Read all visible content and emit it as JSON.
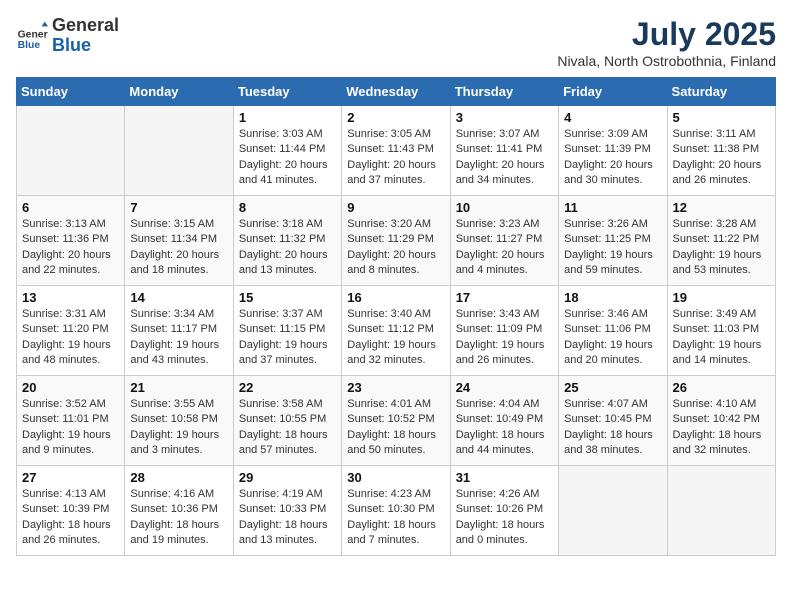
{
  "header": {
    "logo": {
      "general": "General",
      "blue": "Blue"
    },
    "title": "July 2025",
    "subtitle": "Nivala, North Ostrobothnia, Finland"
  },
  "columns": [
    "Sunday",
    "Monday",
    "Tuesday",
    "Wednesday",
    "Thursday",
    "Friday",
    "Saturday"
  ],
  "weeks": [
    [
      {
        "day": "",
        "info": ""
      },
      {
        "day": "",
        "info": ""
      },
      {
        "day": "1",
        "info": "Sunrise: 3:03 AM\nSunset: 11:44 PM\nDaylight: 20 hours\nand 41 minutes."
      },
      {
        "day": "2",
        "info": "Sunrise: 3:05 AM\nSunset: 11:43 PM\nDaylight: 20 hours\nand 37 minutes."
      },
      {
        "day": "3",
        "info": "Sunrise: 3:07 AM\nSunset: 11:41 PM\nDaylight: 20 hours\nand 34 minutes."
      },
      {
        "day": "4",
        "info": "Sunrise: 3:09 AM\nSunset: 11:39 PM\nDaylight: 20 hours\nand 30 minutes."
      },
      {
        "day": "5",
        "info": "Sunrise: 3:11 AM\nSunset: 11:38 PM\nDaylight: 20 hours\nand 26 minutes."
      }
    ],
    [
      {
        "day": "6",
        "info": "Sunrise: 3:13 AM\nSunset: 11:36 PM\nDaylight: 20 hours\nand 22 minutes."
      },
      {
        "day": "7",
        "info": "Sunrise: 3:15 AM\nSunset: 11:34 PM\nDaylight: 20 hours\nand 18 minutes."
      },
      {
        "day": "8",
        "info": "Sunrise: 3:18 AM\nSunset: 11:32 PM\nDaylight: 20 hours\nand 13 minutes."
      },
      {
        "day": "9",
        "info": "Sunrise: 3:20 AM\nSunset: 11:29 PM\nDaylight: 20 hours\nand 8 minutes."
      },
      {
        "day": "10",
        "info": "Sunrise: 3:23 AM\nSunset: 11:27 PM\nDaylight: 20 hours\nand 4 minutes."
      },
      {
        "day": "11",
        "info": "Sunrise: 3:26 AM\nSunset: 11:25 PM\nDaylight: 19 hours\nand 59 minutes."
      },
      {
        "day": "12",
        "info": "Sunrise: 3:28 AM\nSunset: 11:22 PM\nDaylight: 19 hours\nand 53 minutes."
      }
    ],
    [
      {
        "day": "13",
        "info": "Sunrise: 3:31 AM\nSunset: 11:20 PM\nDaylight: 19 hours\nand 48 minutes."
      },
      {
        "day": "14",
        "info": "Sunrise: 3:34 AM\nSunset: 11:17 PM\nDaylight: 19 hours\nand 43 minutes."
      },
      {
        "day": "15",
        "info": "Sunrise: 3:37 AM\nSunset: 11:15 PM\nDaylight: 19 hours\nand 37 minutes."
      },
      {
        "day": "16",
        "info": "Sunrise: 3:40 AM\nSunset: 11:12 PM\nDaylight: 19 hours\nand 32 minutes."
      },
      {
        "day": "17",
        "info": "Sunrise: 3:43 AM\nSunset: 11:09 PM\nDaylight: 19 hours\nand 26 minutes."
      },
      {
        "day": "18",
        "info": "Sunrise: 3:46 AM\nSunset: 11:06 PM\nDaylight: 19 hours\nand 20 minutes."
      },
      {
        "day": "19",
        "info": "Sunrise: 3:49 AM\nSunset: 11:03 PM\nDaylight: 19 hours\nand 14 minutes."
      }
    ],
    [
      {
        "day": "20",
        "info": "Sunrise: 3:52 AM\nSunset: 11:01 PM\nDaylight: 19 hours\nand 9 minutes."
      },
      {
        "day": "21",
        "info": "Sunrise: 3:55 AM\nSunset: 10:58 PM\nDaylight: 19 hours\nand 3 minutes."
      },
      {
        "day": "22",
        "info": "Sunrise: 3:58 AM\nSunset: 10:55 PM\nDaylight: 18 hours\nand 57 minutes."
      },
      {
        "day": "23",
        "info": "Sunrise: 4:01 AM\nSunset: 10:52 PM\nDaylight: 18 hours\nand 50 minutes."
      },
      {
        "day": "24",
        "info": "Sunrise: 4:04 AM\nSunset: 10:49 PM\nDaylight: 18 hours\nand 44 minutes."
      },
      {
        "day": "25",
        "info": "Sunrise: 4:07 AM\nSunset: 10:45 PM\nDaylight: 18 hours\nand 38 minutes."
      },
      {
        "day": "26",
        "info": "Sunrise: 4:10 AM\nSunset: 10:42 PM\nDaylight: 18 hours\nand 32 minutes."
      }
    ],
    [
      {
        "day": "27",
        "info": "Sunrise: 4:13 AM\nSunset: 10:39 PM\nDaylight: 18 hours\nand 26 minutes."
      },
      {
        "day": "28",
        "info": "Sunrise: 4:16 AM\nSunset: 10:36 PM\nDaylight: 18 hours\nand 19 minutes."
      },
      {
        "day": "29",
        "info": "Sunrise: 4:19 AM\nSunset: 10:33 PM\nDaylight: 18 hours\nand 13 minutes."
      },
      {
        "day": "30",
        "info": "Sunrise: 4:23 AM\nSunset: 10:30 PM\nDaylight: 18 hours\nand 7 minutes."
      },
      {
        "day": "31",
        "info": "Sunrise: 4:26 AM\nSunset: 10:26 PM\nDaylight: 18 hours\nand 0 minutes."
      },
      {
        "day": "",
        "info": ""
      },
      {
        "day": "",
        "info": ""
      }
    ]
  ]
}
